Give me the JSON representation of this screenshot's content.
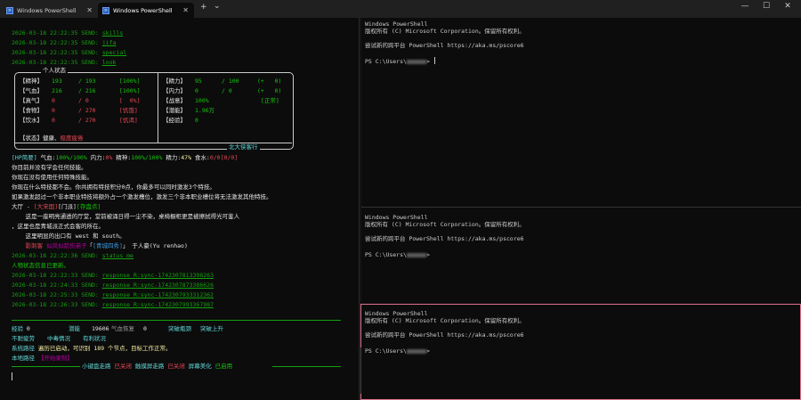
{
  "tabs": [
    {
      "label": "Windows PowerShell",
      "icon": "powershell-icon"
    },
    {
      "label": "Windows PowerShell",
      "icon": "powershell-icon"
    }
  ],
  "window_buttons": {
    "new_tab": "+",
    "dropdown": "⌄",
    "minimize": "—",
    "maximize": "☐",
    "close": "✕"
  },
  "left": {
    "send_lines": [
      {
        "prefix": "2026-03-18 22:22:35 SEND: ",
        "cmd": "skills"
      },
      {
        "prefix": "2026-03-18 22:22:35 SEND: ",
        "cmd": "jifa"
      },
      {
        "prefix": "2026-03-18 22:22:35 SEND: ",
        "cmd": "special"
      },
      {
        "prefix": "2026-03-18 22:22:35 SEND: ",
        "cmd": "look"
      }
    ],
    "status_title": "个人状态",
    "stats_left": [
      {
        "label": "【精神】",
        "cur": "193",
        "max": "/ 193",
        "pct": "[100%]"
      },
      {
        "label": "【气血】",
        "cur": "216",
        "max": "/ 216",
        "pct": "[100%]"
      },
      {
        "label": "【真气】",
        "cur": "0",
        "max": "/ 0",
        "pct": "[  0%]"
      },
      {
        "label": "【食物】",
        "cur": "0",
        "max": "/ 270",
        "pct": "[饥饿]"
      },
      {
        "label": "【饮水】",
        "cur": "0",
        "max": "/ 270",
        "pct": "[饥渴]"
      }
    ],
    "stats_right": [
      {
        "label": "【精力】",
        "v1": "95",
        "v2": "/ 100",
        "v3": "(+   0)"
      },
      {
        "label": "【内力】",
        "v1": "0",
        "v2": "/ 0",
        "v3": "(+   0)"
      },
      {
        "label": "【战意】",
        "v1": "100%",
        "v2": "",
        "v3": "[正常]"
      },
      {
        "label": "【潜能】",
        "v1": "1.96万",
        "v2": "",
        "v3": ""
      },
      {
        "label": "【经验】",
        "v1": "0",
        "v2": "",
        "v3": ""
      }
    ],
    "state_label": "【状态】",
    "state_ok": "健康、",
    "state_bad": "极度疲倦",
    "footer_title": "北大侠客行",
    "hp_line": {
      "tag": "[HP简要]",
      "p1": " 气血:",
      "v1": "100%/100%",
      "p2": " 内力:",
      "v2": "0%",
      "p3": " 精神:",
      "v3": "100%/100%",
      "p4": " 精力:",
      "v4": "47%",
      "p5": " 食水:",
      "v5": "0/0[0/0]"
    },
    "info_lines": [
      "你目前并没有学会任何技能。",
      "你现在没有使用任何特殊技能。",
      "你现在什么特技都不会。你共拥有特技积分0点，你最多可以同时激发3个特技。",
      "如果激发超过一个非本职业特技将额外占一个激发槽位，激发三个非本职业槽位将无法激发其他特技。"
    ],
    "room": {
      "pre": "大厅 - ",
      "place": "[大宋国]",
      "door": "[门派]",
      "save": "[存盘点]"
    },
    "desc1": "    这是一座明亮通透的厅堂，堂前被涌日得一尘不染，桌椅橱柜更是被擦拭得光可鉴人",
    "desc2": "，这里也是青城派正式会客的所在。",
    "exits": "    这里明显的出口有 west 和 south。",
    "npc": {
      "pre": "    ",
      "title": "影刺客",
      "mid": " 似风似箭伤弟子",
      "sect": "[青城四秀]",
      "post": " 于人豪(Yu renhao)"
    },
    "send2": {
      "prefix": "2026-03-18 22:22:36 SEND: ",
      "cmd": "status_me"
    },
    "updated": "人物状态信息已更新。",
    "send3": [
      {
        "prefix": "2026-03-18 22:22:33 SEND: ",
        "cmd": "response R:sync-1742307813398263"
      },
      {
        "prefix": "2026-03-18 22:24:33 SEND: ",
        "cmd": "response R:sync-1742307873386626"
      },
      {
        "prefix": "2026-03-18 22:25:33 SEND: ",
        "cmd": "response R:sync-1742307933312362"
      },
      {
        "prefix": "2026-03-18 22:26:33 SEND: ",
        "cmd": "response R:sync-1742307993367987"
      }
    ],
    "bottom": {
      "exp_l": "经验",
      "exp_v": "0",
      "pot_l": "潜能",
      "pot_v": "19606",
      "hp_l": "气血恢复",
      "hp_v": "0",
      "rb1": "突破瓶颈",
      "rb2": "突破上升",
      "row2": [
        "不耐疲劳",
        "中毒情况",
        "有利状况"
      ],
      "row3_l": "系统路径",
      "row3_v": "遍历已启动，可识别 189 个节点，目标工作正常。",
      "row4_l": "本地路径",
      "row4_v": "【开始录制】",
      "row5_pre": "小键盘走路",
      "row5_a": "已关闭",
      "row5_b": "触摸屏走路",
      "row5_c": "已关闭",
      "row5_d": "屏幕美化",
      "row5_e": "已启用"
    }
  },
  "right": {
    "header": "Windows PowerShell",
    "copyright": "版权所有 (C) Microsoft Corporation。保留所有权利。",
    "tip": "尝试新的跨平台 PowerShell https://aka.ms/pscore6",
    "prompt_pre": "PS C:\\Users\\",
    "prompt_end": ">"
  }
}
